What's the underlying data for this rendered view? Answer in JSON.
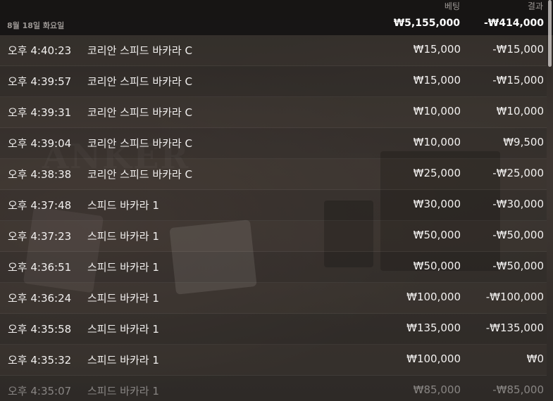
{
  "header": {
    "bet_col": "베팅",
    "result_col": "결과"
  },
  "date_group": {
    "date": "8월 18일 화요일",
    "total_bet": "₩5,155,000",
    "total_result": "-₩414,000"
  },
  "rows": [
    {
      "time": "오후 4:40:23",
      "game": "코리안 스피드 바카라 C",
      "bet": "₩15,000",
      "result": "-₩15,000"
    },
    {
      "time": "오후 4:39:57",
      "game": "코리안 스피드 바카라 C",
      "bet": "₩15,000",
      "result": "-₩15,000"
    },
    {
      "time": "오후 4:39:31",
      "game": "코리안 스피드 바카라 C",
      "bet": "₩10,000",
      "result": "₩10,000"
    },
    {
      "time": "오후 4:39:04",
      "game": "코리안 스피드 바카라 C",
      "bet": "₩10,000",
      "result": "₩9,500"
    },
    {
      "time": "오후 4:38:38",
      "game": "코리안 스피드 바카라 C",
      "bet": "₩25,000",
      "result": "-₩25,000"
    },
    {
      "time": "오후 4:37:48",
      "game": "스피드 바카라 1",
      "bet": "₩30,000",
      "result": "-₩30,000"
    },
    {
      "time": "오후 4:37:23",
      "game": "스피드 바카라 1",
      "bet": "₩50,000",
      "result": "-₩50,000"
    },
    {
      "time": "오후 4:36:51",
      "game": "스피드 바카라 1",
      "bet": "₩50,000",
      "result": "-₩50,000"
    },
    {
      "time": "오후 4:36:24",
      "game": "스피드 바카라 1",
      "bet": "₩100,000",
      "result": "-₩100,000"
    },
    {
      "time": "오후 4:35:58",
      "game": "스피드 바카라 1",
      "bet": "₩135,000",
      "result": "-₩135,000"
    },
    {
      "time": "오후 4:35:32",
      "game": "스피드 바카라 1",
      "bet": "₩100,000",
      "result": "₩0"
    },
    {
      "time": "오후 4:35:07",
      "game": "스피드 바카라 1",
      "bet": "₩85,000",
      "result": "-₩85,000"
    }
  ]
}
